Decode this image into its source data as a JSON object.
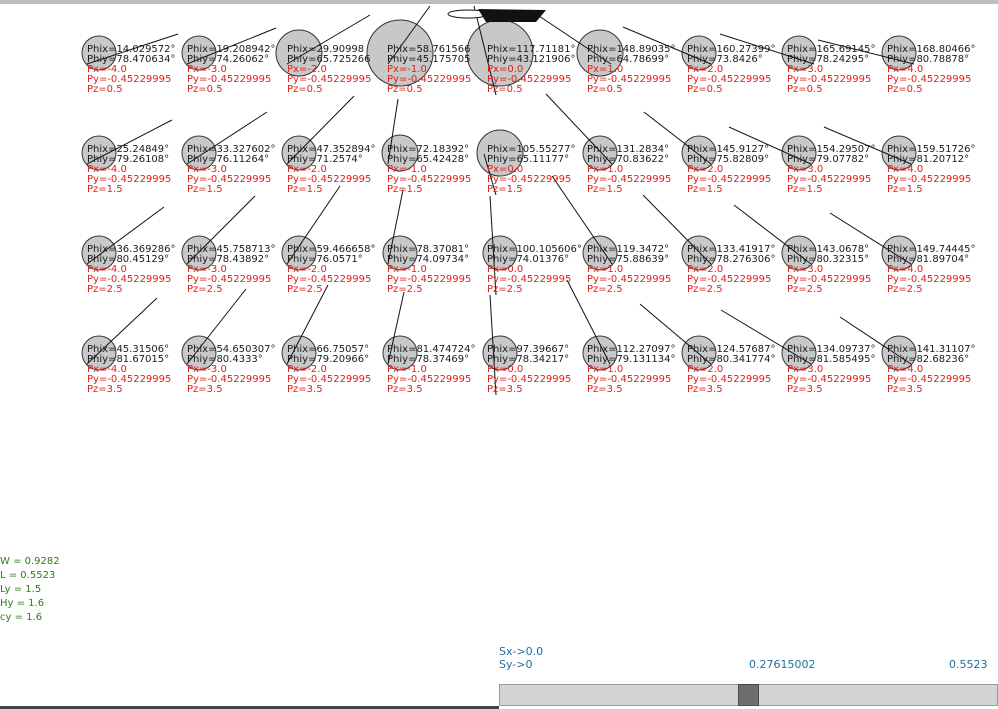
{
  "colors": {
    "black_text": "#1a1a1a",
    "red_text": "#e0201a",
    "green_text": "#2e7d1a",
    "blue_text": "#1f6f9e",
    "circle_fill": "#c8c8c8"
  },
  "grid": [
    [
      {
        "phix": "Phix=14.029572°",
        "phiy": "Phiy=78.470634°",
        "px": "Px=-4.0",
        "py": "Py=-0.45229995",
        "pz": "Pz=0.5"
      },
      {
        "phix": "Phix=19.208942°",
        "phiy": "Phiy=74.26062°",
        "px": "Px=-3.0",
        "py": "Py=-0.45229995",
        "pz": "Pz=0.5"
      },
      {
        "phix": "Phix=29.90998",
        "phiy": "Phiy=65.725266",
        "px": "Px=-2.0",
        "py": "Py=-0.45229995",
        "pz": "Pz=0.5"
      },
      {
        "phix": "Phix=58.761566",
        "phiy": "Phiy=45.175705",
        "px": "Px=-1.0",
        "py": "Py=-0.45229995",
        "pz": "Pz=0.5"
      },
      {
        "phix": "Phix=117.71181°",
        "phiy": "Phiy=43.121906°",
        "px": "Px=0.0",
        "py": "Py=-0.45229995",
        "pz": "Pz=0.5"
      },
      {
        "phix": "Phix=148.89035°",
        "phiy": "Phiy=64.78699°",
        "px": "Px=1.0",
        "py": "Py=-0.45229995",
        "pz": "Pz=0.5"
      },
      {
        "phix": "Phix=160.27399°",
        "phiy": "Phiy=73.8426°",
        "px": "Px=2.0",
        "py": "Py=-0.45229995",
        "pz": "Pz=0.5"
      },
      {
        "phix": "Phix=165.69145°",
        "phiy": "Phiy=78.24295°",
        "px": "Px=3.0",
        "py": "Py=-0.45229995",
        "pz": "Pz=0.5"
      },
      {
        "phix": "Phix=168.80466°",
        "phiy": "Phiy=80.78878°",
        "px": "Px=4.0",
        "py": "Py=-0.45229995",
        "pz": "Pz=0.5"
      }
    ],
    [
      {
        "phix": "Phix=25.24849°",
        "phiy": "Phiy=79.26108°",
        "px": "Px=-4.0",
        "py": "Py=-0.45229995",
        "pz": "Pz=1.5"
      },
      {
        "phix": "Phix=33.327602°",
        "phiy": "Phiy=76.11264°",
        "px": "Px=-3.0",
        "py": "Py=-0.45229995",
        "pz": "Pz=1.5"
      },
      {
        "phix": "Phix=47.352894°",
        "phiy": "Phiy=71.2574°",
        "px": "Px=-2.0",
        "py": "Py=-0.45229995",
        "pz": "Pz=1.5"
      },
      {
        "phix": "Phix=72.18392°",
        "phiy": "Phiy=65.42428°",
        "px": "Px=-1.0",
        "py": "Py=-0.45229995",
        "pz": "Pz=1.5"
      },
      {
        "phix": "Phix=105.55277°",
        "phiy": "Phiy=65.11177°",
        "px": "Px=0.0",
        "py": "Py=-0.45229995",
        "pz": "Pz=1.5"
      },
      {
        "phix": "Phix=131.2834°",
        "phiy": "Phiy=70.83622°",
        "px": "Px=1.0",
        "py": "Py=-0.45229995",
        "pz": "Pz=1.5"
      },
      {
        "phix": "Phix=145.9127°",
        "phiy": "Phiy=75.82809°",
        "px": "Px=2.0",
        "py": "Py=-0.45229995",
        "pz": "Pz=1.5"
      },
      {
        "phix": "Phix=154.29507°",
        "phiy": "Phiy=79.07782°",
        "px": "Px=3.0",
        "py": "Py=-0.45229995",
        "pz": "Pz=1.5"
      },
      {
        "phix": "Phix=159.51726°",
        "phiy": "Phiy=81.20712°",
        "px": "Px=4.0",
        "py": "Py=-0.45229995",
        "pz": "Pz=1.5"
      }
    ],
    [
      {
        "phix": "Phix=36.369286°",
        "phiy": "Phiy=80.45129°",
        "px": "Px=-4.0",
        "py": "Py=-0.45229995",
        "pz": "Pz=2.5"
      },
      {
        "phix": "Phix=45.758713°",
        "phiy": "Phiy=78.43892°",
        "px": "Px=-3.0",
        "py": "Py=-0.45229995",
        "pz": "Pz=2.5"
      },
      {
        "phix": "Phix=59.466658°",
        "phiy": "Phiy=76.0571°",
        "px": "Px=-2.0",
        "py": "Py=-0.45229995",
        "pz": "Pz=2.5"
      },
      {
        "phix": "Phix=78.37081°",
        "phiy": "Phiy=74.09734°",
        "px": "Px=-1.0",
        "py": "Py=-0.45229995",
        "pz": "Pz=2.5"
      },
      {
        "phix": "Phix=100.105606°",
        "phiy": "Phiy=74.01376°",
        "px": "Px=0.0",
        "py": "Py=-0.45229995",
        "pz": "Pz=2.5"
      },
      {
        "phix": "Phix=119.3472°",
        "phiy": "Phiy=75.88639°",
        "px": "Px=1.0",
        "py": "Py=-0.45229995",
        "pz": "Pz=2.5"
      },
      {
        "phix": "Phix=133.41917°",
        "phiy": "Phiy=78.276306°",
        "px": "Px=2.0",
        "py": "Py=-0.45229995",
        "pz": "Pz=2.5"
      },
      {
        "phix": "Phix=143.0678°",
        "phiy": "Phiy=80.32315°",
        "px": "Px=3.0",
        "py": "Py=-0.45229995",
        "pz": "Pz=2.5"
      },
      {
        "phix": "Phix=149.74445°",
        "phiy": "Phiy=81.89704°",
        "px": "Px=4.0",
        "py": "Py=-0.45229995",
        "pz": "Pz=2.5"
      }
    ],
    [
      {
        "phix": "Phix=45.31506°",
        "phiy": "Phiy=81.67015°",
        "px": "Px=-4.0",
        "py": "Py=-0.45229995",
        "pz": "Pz=3.5"
      },
      {
        "phix": "Phix=54.650307°",
        "phiy": "Phiy=80.4333°",
        "px": "Px=-3.0",
        "py": "Py=-0.45229995",
        "pz": "Pz=3.5"
      },
      {
        "phix": "Phix=66.75057°",
        "phiy": "Phiy=79.20966°",
        "px": "Px=-2.0",
        "py": "Py=-0.45229995",
        "pz": "Pz=3.5"
      },
      {
        "phix": "Phix=81.474724°",
        "phiy": "Phiy=78.37469°",
        "px": "Px=-1.0",
        "py": "Py=-0.45229995",
        "pz": "Pz=3.5"
      },
      {
        "phix": "Phix=97.39667°",
        "phiy": "Phiy=78.34217°",
        "px": "Px=0.0",
        "py": "Py=-0.45229995",
        "pz": "Pz=3.5"
      },
      {
        "phix": "Phix=112.27097°",
        "phiy": "Phiy=79.131134°",
        "px": "Px=1.0",
        "py": "Py=-0.45229995",
        "pz": "Pz=3.5"
      },
      {
        "phix": "Phix=124.57687°",
        "phiy": "Phiy=80.341774°",
        "px": "Px=2.0",
        "py": "Py=-0.45229995",
        "pz": "Pz=3.5"
      },
      {
        "phix": "Phix=134.09737°",
        "phiy": "Phiy=81.585495°",
        "px": "Px=3.0",
        "py": "Py=-0.45229995",
        "pz": "Pz=3.5"
      },
      {
        "phix": "Phix=141.31107°",
        "phiy": "Phiy=82.68236°",
        "px": "Px=4.0",
        "py": "Py=-0.45229995",
        "pz": "Pz=3.5"
      }
    ]
  ],
  "params": [
    "W = 0.9282",
    "L = 0.5523",
    "Ly = 1.5",
    "Hy = 1.6",
    "cy = 1.6"
  ],
  "sx_label": "Sx->0.0",
  "sy_label": "Sy->0",
  "slider": {
    "current_value": "0.27615002",
    "max_value": "0.5523",
    "fraction": 0.5
  }
}
